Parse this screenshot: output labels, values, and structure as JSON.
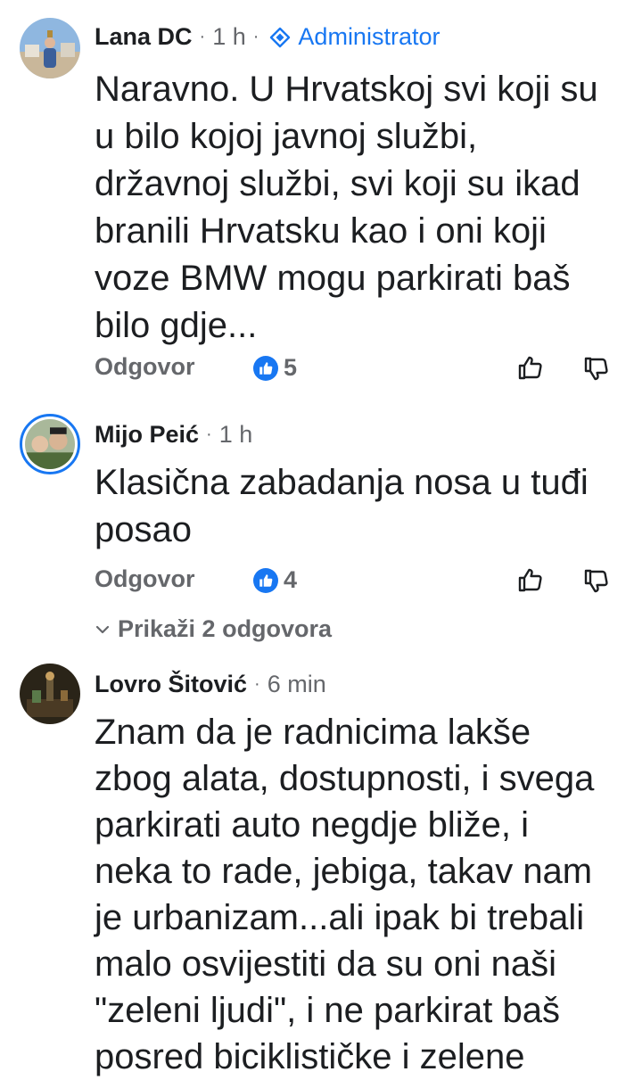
{
  "colors": {
    "accent": "#1877f2",
    "secondary_text": "#65676b",
    "primary_text": "#1c1e21"
  },
  "comments": [
    {
      "author": "Lana DC",
      "time": "1 h",
      "role": "Administrator",
      "role_icon": "admin-badge-icon",
      "text": "Naravno. U Hrvatskoj svi koji su\nu bilo kojoj javnoj službi,\ndržavnoj službi, svi koji su ikad\nbranili Hrvatsku kao i oni koji\nvoze BMW mogu parkirati baš\nbilo gdje...",
      "reply_label": "Odgovor",
      "reaction_icon": "like-icon",
      "reaction_count": "5"
    },
    {
      "author": "Mijo Peić",
      "time": "1 h",
      "text": "Klasična zabadanja nosa u tuđi\nposao",
      "reply_label": "Odgovor",
      "reaction_icon": "like-icon",
      "reaction_count": "4",
      "replies_toggle": "Prikaži 2 odgovora"
    },
    {
      "author": "Lovro Šitović",
      "time": "6 min",
      "text": "Znam da je radnicima lakše\nzbog alata, dostupnosti, i svega\nparkirati auto negdje bliže, i\nneka to rade, jebiga, takav nam\nje urbanizam...ali ipak bi trebali\nmalo osvijestiti da su oni naši\n\"zeleni ljudi\", i ne parkirat baš\nposred biciklističke i zelene"
    }
  ]
}
